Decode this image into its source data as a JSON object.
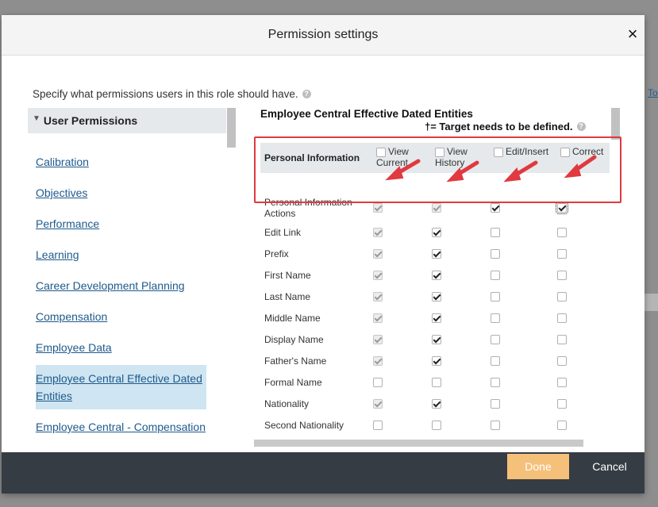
{
  "background": {
    "edge_link": "To"
  },
  "dialog": {
    "title": "Permission settings",
    "close_glyph": "×",
    "intro": "Specify what permissions users in this role should have.",
    "help_glyph": "?"
  },
  "nav": {
    "header": "User Permissions",
    "expand_glyph": "▼",
    "items": [
      {
        "label": "Calibration"
      },
      {
        "label": "Objectives"
      },
      {
        "label": "Performance"
      },
      {
        "label": "Learning"
      },
      {
        "label": "Career Development Planning"
      },
      {
        "label": "Compensation"
      },
      {
        "label": "Employee Data"
      },
      {
        "label": "Employee Central Effective Dated Entities",
        "active": true
      },
      {
        "label": "Employee Central - Compensation Integration"
      }
    ]
  },
  "panel": {
    "title": "Employee Central Effective Dated Entities",
    "note": "†= Target needs to be defined.",
    "table": {
      "header_label": "Personal Information",
      "columns": [
        "View Current",
        "View History",
        "Edit/Insert",
        "Correct"
      ],
      "rows": [
        {
          "label": "Personal Information Actions",
          "checks": [
            [
              true,
              true
            ],
            [
              true,
              true
            ],
            [
              true,
              false
            ],
            [
              true,
              false
            ]
          ]
        },
        {
          "label": "Edit Link",
          "checks": [
            [
              true,
              true
            ],
            [
              true,
              false
            ],
            [
              false,
              false
            ],
            [
              false,
              false
            ]
          ]
        },
        {
          "label": "Prefix",
          "checks": [
            [
              true,
              true
            ],
            [
              true,
              false
            ],
            [
              false,
              false
            ],
            [
              false,
              false
            ]
          ]
        },
        {
          "label": "First Name",
          "checks": [
            [
              true,
              true
            ],
            [
              true,
              false
            ],
            [
              false,
              false
            ],
            [
              false,
              false
            ]
          ]
        },
        {
          "label": "Last Name",
          "checks": [
            [
              true,
              true
            ],
            [
              true,
              false
            ],
            [
              false,
              false
            ],
            [
              false,
              false
            ]
          ]
        },
        {
          "label": "Middle Name",
          "checks": [
            [
              true,
              true
            ],
            [
              true,
              false
            ],
            [
              false,
              false
            ],
            [
              false,
              false
            ]
          ]
        },
        {
          "label": "Display Name",
          "checks": [
            [
              true,
              true
            ],
            [
              true,
              false
            ],
            [
              false,
              false
            ],
            [
              false,
              false
            ]
          ]
        },
        {
          "label": "Father's Name",
          "checks": [
            [
              true,
              true
            ],
            [
              true,
              false
            ],
            [
              false,
              false
            ],
            [
              false,
              false
            ]
          ]
        },
        {
          "label": "Formal Name",
          "checks": [
            [
              false,
              false
            ],
            [
              false,
              false
            ],
            [
              false,
              false
            ],
            [
              false,
              false
            ]
          ]
        },
        {
          "label": "Nationality",
          "checks": [
            [
              true,
              true
            ],
            [
              true,
              false
            ],
            [
              false,
              false
            ],
            [
              false,
              false
            ]
          ]
        },
        {
          "label": "Second Nationality",
          "checks": [
            [
              false,
              false
            ],
            [
              false,
              false
            ],
            [
              false,
              false
            ],
            [
              false,
              false
            ]
          ]
        }
      ]
    }
  },
  "footer": {
    "done_label": "Done",
    "cancel_label": "Cancel"
  },
  "colors": {
    "annotation": "#e0393f",
    "done": "#f5c07a",
    "footer": "#363c44",
    "link": "#1e5a8c"
  }
}
